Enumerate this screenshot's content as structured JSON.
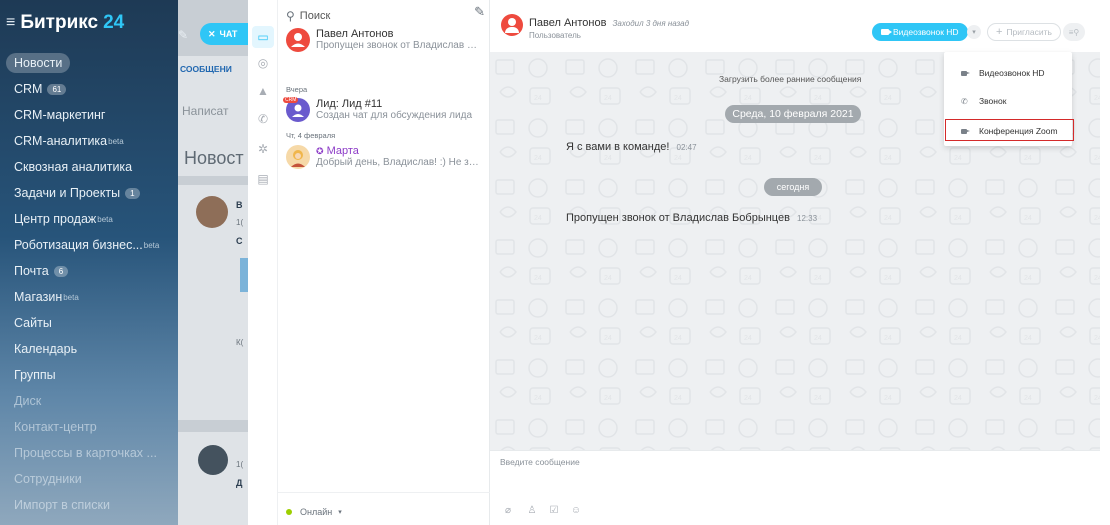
{
  "app": {
    "brand": "Битрикс",
    "brand_number": "24",
    "chat_button": "ЧАТ"
  },
  "nav": {
    "items": [
      {
        "label": "Новости",
        "count": "",
        "sup": "",
        "active": true
      },
      {
        "label": "CRM",
        "count": "61",
        "sup": ""
      },
      {
        "label": "CRM-маркетинг",
        "count": "",
        "sup": ""
      },
      {
        "label": "CRM-аналитика",
        "count": "",
        "sup": "beta"
      },
      {
        "label": "Сквозная аналитика",
        "count": "",
        "sup": ""
      },
      {
        "label": "Задачи и Проекты",
        "count": "1",
        "sup": ""
      },
      {
        "label": "Центр продаж",
        "count": "",
        "sup": "beta"
      },
      {
        "label": "Роботизация бизнес...",
        "count": "",
        "sup": "beta"
      },
      {
        "label": "Почта",
        "count": "6",
        "sup": ""
      },
      {
        "label": "Магазин",
        "count": "",
        "sup": "beta"
      },
      {
        "label": "Сайты",
        "count": "",
        "sup": ""
      },
      {
        "label": "Календарь",
        "count": "",
        "sup": ""
      },
      {
        "label": "Группы",
        "count": "",
        "sup": ""
      },
      {
        "label": "Диск",
        "count": "",
        "sup": ""
      },
      {
        "label": "Контакт-центр",
        "count": "",
        "sup": ""
      },
      {
        "label": "Процессы в карточках ...",
        "count": "",
        "sup": ""
      },
      {
        "label": "Сотрудники",
        "count": "",
        "sup": ""
      },
      {
        "label": "Импорт в списки",
        "count": "",
        "sup": ""
      }
    ]
  },
  "background_page": {
    "tab_label": "СООБЩЕНИ",
    "write_placeholder": "Написат",
    "title": "Новост",
    "letters": [
      "В",
      "1(",
      "С",
      "К(",
      "1(",
      "Д"
    ]
  },
  "recent": {
    "search_placeholder": "Поиск",
    "sections": [
      "Вчера",
      "Чт, 4 февраля"
    ],
    "items": [
      {
        "name": "Павел Антонов",
        "sub": "Пропущен звонок от Владислав Бо...",
        "avatar_color": "#ee4a3e"
      },
      {
        "name": "Лид: Лид #11",
        "sub": "Создан чат для обсуждения лида",
        "badge": "CRM",
        "avatar_color": "#6a5acd"
      },
      {
        "name": "Марта",
        "sub": "Добрый день, Владислав! :) Не заб...",
        "avatar_color": "#f0b64b"
      }
    ],
    "status": "Онлайн"
  },
  "chat": {
    "name": "Павел Антонов",
    "last_seen": "Заходил 3 дня назад",
    "role": "Пользователь",
    "video_button": "Видеозвонок HD",
    "invite_button": "Пригласить",
    "load_earlier": "Загрузить более ранние сообщения",
    "date_divider": "Среда, 10 февраля 2021",
    "today_divider": "сегодня",
    "messages": [
      {
        "text": "Я с вами в команде!",
        "time": "02:47"
      },
      {
        "text": "Пропущен звонок от Владислав Бобрынцев",
        "time": "12:33"
      }
    ],
    "input_placeholder": "Введите сообщение"
  },
  "call_menu": {
    "items": [
      {
        "label": "Видеозвонок HD",
        "icon": "video-camera-icon"
      },
      {
        "label": "Звонок",
        "icon": "phone-icon"
      },
      {
        "label": "Конференция Zoom",
        "icon": "video-camera-icon",
        "highlighted": true
      }
    ]
  },
  "colors": {
    "accent": "#2fc6f6",
    "highlight_border": "#d42a2a",
    "chat_bg": "#eef0f2"
  }
}
